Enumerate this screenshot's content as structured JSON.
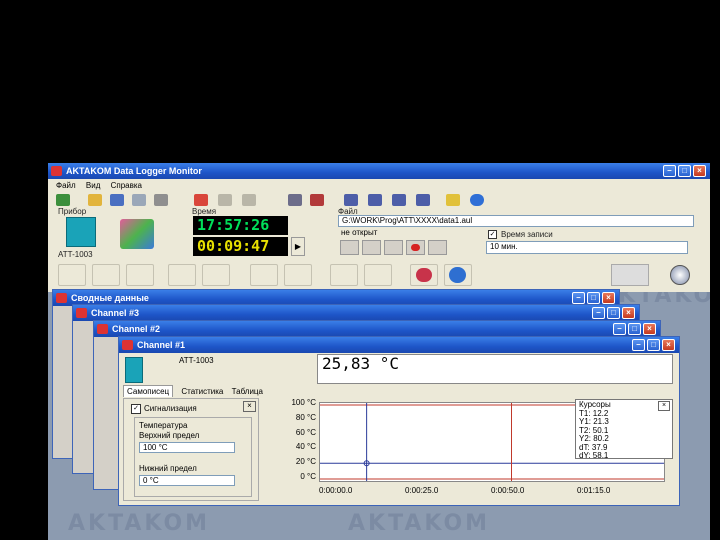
{
  "window": {
    "title": "AKTAKOM Data Logger Monitor",
    "menu": [
      "Файл",
      "Вид",
      "Справка"
    ]
  },
  "device": {
    "label": "Прибор",
    "name": "ATT-1003"
  },
  "time": {
    "label": "Время",
    "clock": "17:57:26",
    "elapsed": "00:09:47"
  },
  "file": {
    "label": "Файл",
    "path": "G:\\WORK\\Prog\\ATT\\XXXX\\data1.aul",
    "status": "не открыт",
    "record_time_label": "Время записи",
    "record_time_value": "10 мин."
  },
  "windows": {
    "summary_title": "Сводные данные",
    "channel3_title": "Channel #3",
    "channel2_title": "Channel #2",
    "channel1_title": "Channel #1"
  },
  "channel1": {
    "device": "ATT-1003",
    "reading": "25,83  °С",
    "tabs": [
      "Самописец",
      "Статистика",
      "Таблица"
    ],
    "alarm_label": "Сигнализация",
    "temp_group": "Температура",
    "upper_label": "Верхний предел",
    "upper_value": "100 °C",
    "lower_label": "Нижний предел",
    "lower_value": "0 °C"
  },
  "cursors": {
    "title": "Курсоры",
    "lines": [
      "T1: 12.2",
      "Y1: 21.3",
      "T2: 50.1",
      "Y2: 80.2",
      "dT: 37.9",
      "dY: 58.1"
    ]
  },
  "chart_data": {
    "type": "line",
    "y_ticks": [
      "100 °C",
      "80 °C",
      "60 °C",
      "40 °C",
      "20 °C",
      "0 °C"
    ],
    "x_ticks": [
      "0:00:00.0",
      "0:00:25.0",
      "0:00:50.0",
      "0:01:15.0"
    ],
    "ylim": [
      0,
      100
    ],
    "upper_limit": 100,
    "lower_limit": 0,
    "series": [
      {
        "values": [
          21.3,
          21.3,
          21.3,
          21.3,
          21.3,
          21.3
        ]
      }
    ],
    "cursor_t": [
      12.2,
      50.1
    ],
    "colors": {
      "limit": "#c0392b",
      "series": "#2a3a9a"
    }
  }
}
